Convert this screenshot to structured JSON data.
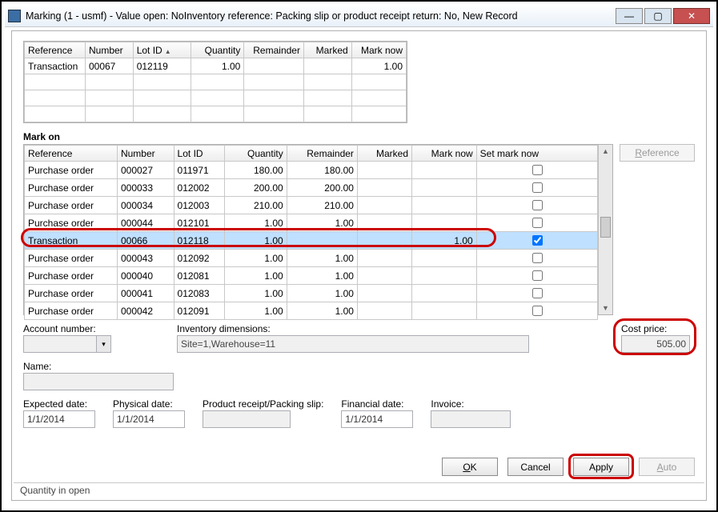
{
  "window": {
    "title": "Marking (1 - usmf) - Value open: NoInventory reference: Packing slip or product receipt return: No, New Record"
  },
  "topGrid": {
    "headers": [
      "Reference",
      "Number",
      "Lot ID",
      "Quantity",
      "Remainder",
      "Marked",
      "Mark now"
    ],
    "row": {
      "reference": "Transaction",
      "number": "00067",
      "lotid": "012119",
      "quantity": "1.00",
      "remainder": "",
      "marked": "",
      "marknow": "1.00"
    }
  },
  "markOn": {
    "label": "Mark on",
    "headers": [
      "Reference",
      "Number",
      "Lot ID",
      "Quantity",
      "Remainder",
      "Marked",
      "Mark now",
      "Set mark now"
    ],
    "rows": [
      {
        "reference": "Purchase order",
        "number": "000027",
        "lotid": "011971",
        "quantity": "180.00",
        "remainder": "180.00",
        "marked": "",
        "marknow": "",
        "set": false
      },
      {
        "reference": "Purchase order",
        "number": "000033",
        "lotid": "012002",
        "quantity": "200.00",
        "remainder": "200.00",
        "marked": "",
        "marknow": "",
        "set": false
      },
      {
        "reference": "Purchase order",
        "number": "000034",
        "lotid": "012003",
        "quantity": "210.00",
        "remainder": "210.00",
        "marked": "",
        "marknow": "",
        "set": false
      },
      {
        "reference": "Purchase order",
        "number": "000044",
        "lotid": "012101",
        "quantity": "1.00",
        "remainder": "1.00",
        "marked": "",
        "marknow": "",
        "set": false
      },
      {
        "reference": "Transaction",
        "number": "00066",
        "lotid": "012118",
        "quantity": "1.00",
        "remainder": "",
        "marked": "",
        "marknow": "1.00",
        "set": true,
        "highlight": true
      },
      {
        "reference": "Purchase order",
        "number": "000043",
        "lotid": "012092",
        "quantity": "1.00",
        "remainder": "1.00",
        "marked": "",
        "marknow": "",
        "set": false
      },
      {
        "reference": "Purchase order",
        "number": "000040",
        "lotid": "012081",
        "quantity": "1.00",
        "remainder": "1.00",
        "marked": "",
        "marknow": "",
        "set": false
      },
      {
        "reference": "Purchase order",
        "number": "000041",
        "lotid": "012083",
        "quantity": "1.00",
        "remainder": "1.00",
        "marked": "",
        "marknow": "",
        "set": false
      },
      {
        "reference": "Purchase order",
        "number": "000042",
        "lotid": "012091",
        "quantity": "1.00",
        "remainder": "1.00",
        "marked": "",
        "marknow": "",
        "set": false
      }
    ],
    "refButton": "Reference"
  },
  "fields": {
    "account_label": "Account number:",
    "account_value": "",
    "invdim_label": "Inventory dimensions:",
    "invdim_value": "Site=1,Warehouse=11",
    "cost_label": "Cost price:",
    "cost_value": "505.00",
    "name_label": "Name:",
    "name_value": "",
    "expected_label": "Expected date:",
    "expected_value": "1/1/2014",
    "physical_label": "Physical date:",
    "physical_value": "1/1/2014",
    "prodreceipt_label": "Product receipt/Packing slip:",
    "prodreceipt_value": "",
    "financial_label": "Financial date:",
    "financial_value": "1/1/2014",
    "invoice_label": "Invoice:",
    "invoice_value": ""
  },
  "buttons": {
    "ok": "OK",
    "cancel": "Cancel",
    "apply": "Apply",
    "auto": "Auto"
  },
  "status": "Quantity in open"
}
